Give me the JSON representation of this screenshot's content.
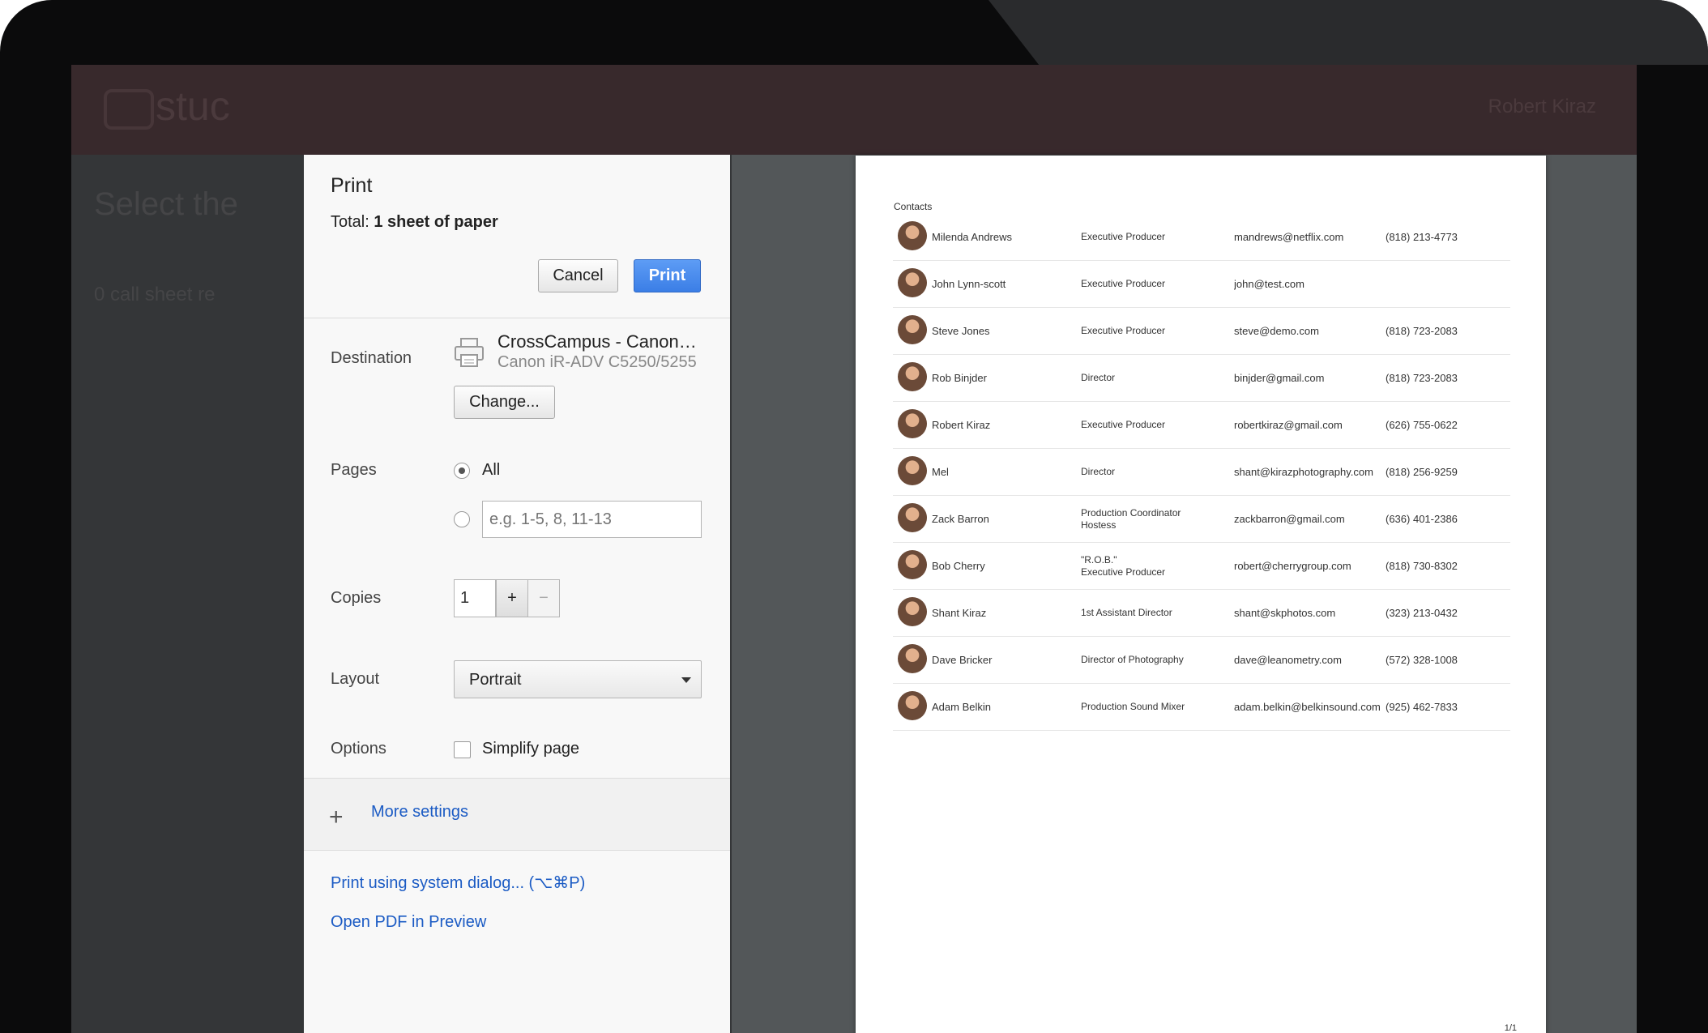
{
  "background_app": {
    "logo_text": "stuc",
    "user_name": "Robert Kiraz",
    "heading": "Select the",
    "subtext": "0 call sheet re"
  },
  "dialog": {
    "title": "Print",
    "total_label": "Total:",
    "total_value": "1 sheet of paper",
    "cancel_label": "Cancel",
    "print_label": "Print",
    "destination_label": "Destination",
    "destination_name": "CrossCampus - Canon iR-ADV C5250/5255",
    "destination_model": "Canon iR-ADV C5250/5255",
    "change_label": "Change...",
    "pages_label": "Pages",
    "pages_all_label": "All",
    "pages_selected": "all",
    "pages_placeholder": "e.g. 1-5, 8, 11-13",
    "copies_label": "Copies",
    "copies_value": "1",
    "copies_plus": "+",
    "copies_minus": "−",
    "layout_label": "Layout",
    "layout_value": "Portrait",
    "options_label": "Options",
    "simplify_label": "Simplify page",
    "simplify_checked": false,
    "more_settings_label": "More settings",
    "system_dialog_label": "Print using system dialog... (⌥⌘P)",
    "open_pdf_label": "Open PDF in Preview",
    "accent_color": "#3b7ee6",
    "link_color": "#1b5bc4"
  },
  "preview": {
    "title": "Contacts",
    "page_number": "1/1",
    "contacts": [
      {
        "name": "Milenda Andrews",
        "role": "Executive Producer",
        "email": "mandrews@netflix.com",
        "phone": "(818) 213-4773"
      },
      {
        "name": "John Lynn-scott",
        "role": "Executive Producer",
        "email": "john@test.com",
        "phone": ""
      },
      {
        "name": "Steve Jones",
        "role": "Executive Producer",
        "email": "steve@demo.com",
        "phone": "(818) 723-2083"
      },
      {
        "name": "Rob Binjder",
        "role": "Director",
        "email": "binjder@gmail.com",
        "phone": "(818) 723-2083"
      },
      {
        "name": "Robert Kiraz",
        "role": "Executive Producer",
        "email": "robertkiraz@gmail.com",
        "phone": "(626) 755-0622"
      },
      {
        "name": "Mel",
        "role": "Director",
        "email": "shant@kirazphotography.com",
        "phone": "(818) 256-9259"
      },
      {
        "name": "Zack Barron",
        "role": "Production Coordinator\nHostess",
        "email": "zackbarron@gmail.com",
        "phone": "(636) 401-2386"
      },
      {
        "name": "Bob Cherry",
        "role": "\"R.O.B.\"\nExecutive Producer",
        "email": "robert@cherrygroup.com",
        "phone": "(818) 730-8302"
      },
      {
        "name": "Shant Kiraz",
        "role": "1st Assistant Director",
        "email": "shant@skphotos.com",
        "phone": "(323) 213-0432"
      },
      {
        "name": "Dave Bricker",
        "role": "Director of Photography",
        "email": "dave@leanometry.com",
        "phone": "(572) 328-1008"
      },
      {
        "name": "Adam Belkin",
        "role": "Production Sound Mixer",
        "email": "adam.belkin@belkinsound.com",
        "phone": "(925) 462-7833"
      }
    ]
  }
}
